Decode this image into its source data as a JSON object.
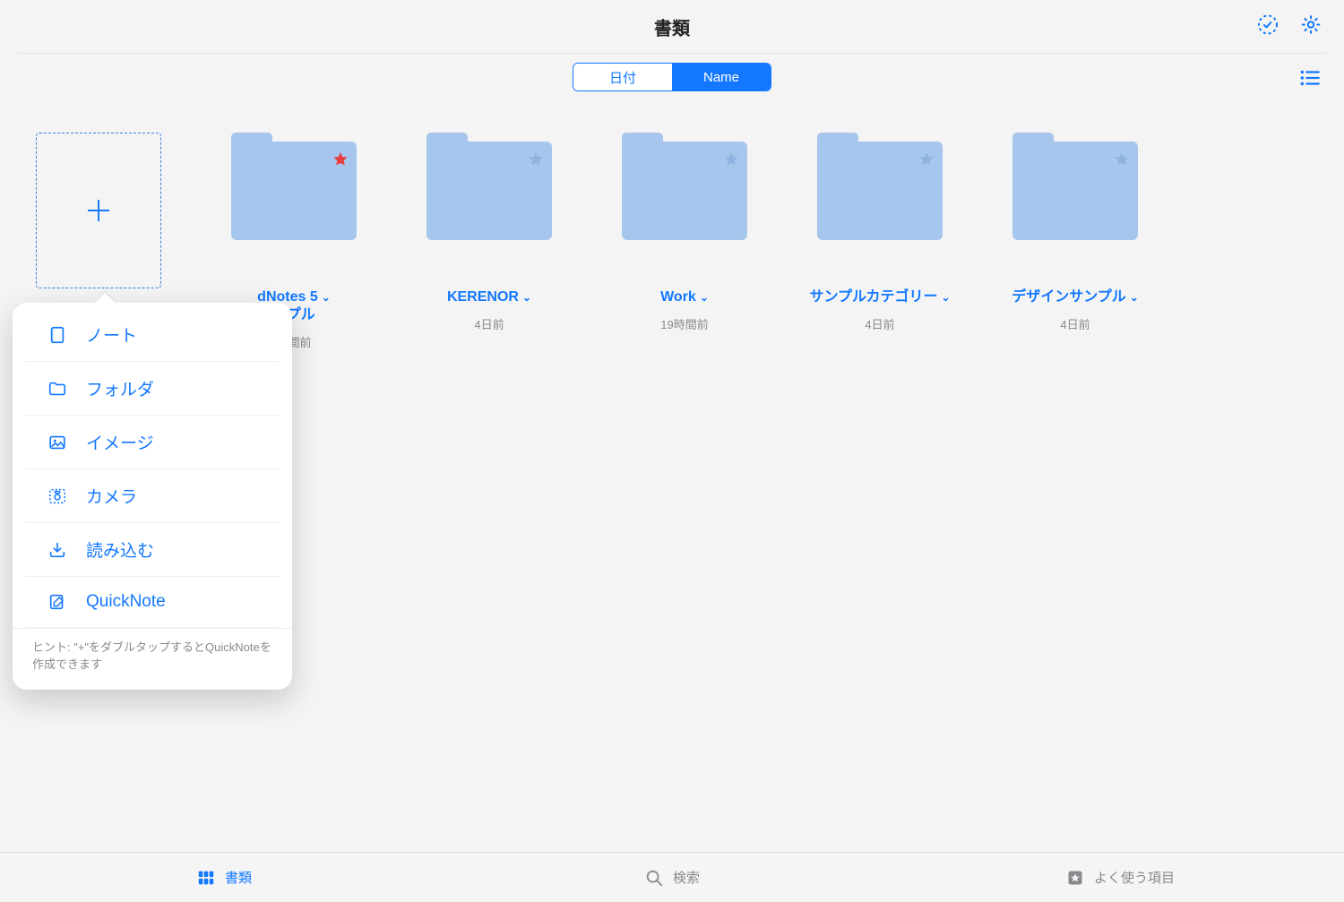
{
  "header": {
    "title": "書類"
  },
  "sort": {
    "options": [
      "日付",
      "Name"
    ],
    "active_index": 1
  },
  "folders": [
    {
      "name_lines": [
        "dNotes 5",
        "ンプル"
      ],
      "time": "時間前",
      "favorite": true
    },
    {
      "name_lines": [
        "KERENOR"
      ],
      "time": "4日前",
      "favorite": false
    },
    {
      "name_lines": [
        "Work"
      ],
      "time": "19時間前",
      "favorite": false
    },
    {
      "name_lines": [
        "サンプルカテゴリー"
      ],
      "time": "4日前",
      "favorite": false
    },
    {
      "name_lines": [
        "デザインサンプル"
      ],
      "time": "4日前",
      "favorite": false
    }
  ],
  "create_menu": {
    "items": [
      {
        "icon": "notebook-icon",
        "label": "ノート"
      },
      {
        "icon": "folder-icon",
        "label": "フォルダ"
      },
      {
        "icon": "image-icon",
        "label": "イメージ"
      },
      {
        "icon": "camera-icon",
        "label": "カメラ"
      },
      {
        "icon": "import-icon",
        "label": "読み込む"
      },
      {
        "icon": "edit-icon",
        "label": "QuickNote"
      }
    ],
    "hint": "ヒント: \"+\"をダブルタップするとQuickNoteを作成できます"
  },
  "tabbar": {
    "items": [
      {
        "icon": "grid-icon",
        "label": "書類"
      },
      {
        "icon": "search-icon",
        "label": "検索"
      },
      {
        "icon": "star-icon",
        "label": "よく使う項目"
      }
    ],
    "active_index": 0
  },
  "colors": {
    "accent": "#1378ff",
    "folder": "#a7c6ee",
    "favorite_star": "#e63c3c",
    "muted": "#8a8a8e"
  }
}
